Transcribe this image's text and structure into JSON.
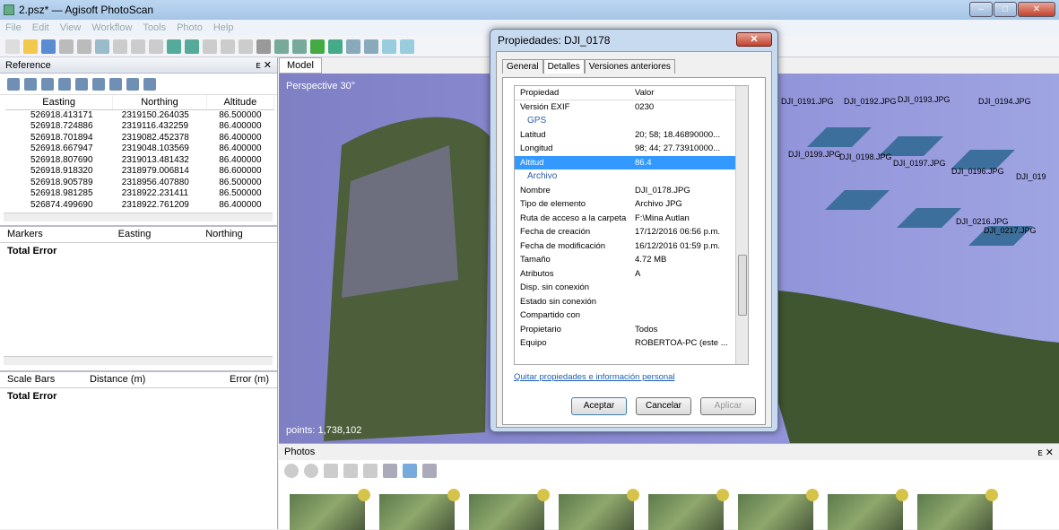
{
  "window": {
    "title": "2.psz* — Agisoft PhotoScan"
  },
  "menu": [
    "File",
    "Edit",
    "View",
    "Workflow",
    "Tools",
    "Photo",
    "Help"
  ],
  "reference": {
    "title": "Reference",
    "columns": [
      "Easting",
      "Northing",
      "Altitude"
    ],
    "rows": [
      [
        "526918.413171",
        "2319150.264035",
        "86.500000"
      ],
      [
        "526918.724886",
        "2319116.432259",
        "86.400000"
      ],
      [
        "526918.701894",
        "2319082.452378",
        "86.400000"
      ],
      [
        "526918.667947",
        "2319048.103569",
        "86.400000"
      ],
      [
        "526918.807690",
        "2319013.481432",
        "86.400000"
      ],
      [
        "526918.918320",
        "2318979.006814",
        "86.600000"
      ],
      [
        "526918.905789",
        "2318956.407880",
        "86.500000"
      ],
      [
        "526918.981285",
        "2318922.231411",
        "86.500000"
      ],
      [
        "526874.499690",
        "2318922.761209",
        "86.400000"
      ]
    ],
    "markers": {
      "columns": [
        "Markers",
        "Easting",
        "Northing"
      ],
      "total": "Total Error"
    },
    "scalebars": {
      "columns": [
        "Scale Bars",
        "Distance (m)",
        "Error (m)"
      ],
      "total": "Total Error"
    }
  },
  "model": {
    "tab": "Model",
    "perspective": "Perspective 30°",
    "points": "points: 1,738,102",
    "cameras": [
      "DJI_0191.JPG",
      "DJI_0192.JPG",
      "DJI_0193.JPG",
      "DJI_0194.JPG",
      "DJI_0199.JPG",
      "DJI_0198.JPG",
      "DJI_0197.JPG",
      "DJI_0196.JPG",
      "DJI_0216.JPG",
      "DJI_0217.JPG",
      "DJI_019"
    ]
  },
  "photos": {
    "title": "Photos"
  },
  "dialog": {
    "title": "Propiedades: DJI_0178",
    "tabs": [
      "General",
      "Detalles",
      "Versiones anteriores"
    ],
    "header": [
      "Propiedad",
      "Valor"
    ],
    "rows": [
      {
        "k": "Versión EXIF",
        "v": "0230"
      },
      {
        "group": "GPS"
      },
      {
        "k": "Latitud",
        "v": "20; 58; 18.46890000..."
      },
      {
        "k": "Longitud",
        "v": "98; 44; 27.73910000..."
      },
      {
        "k": "Altitud",
        "v": "86.4",
        "selected": true
      },
      {
        "group": "Archivo"
      },
      {
        "k": "Nombre",
        "v": "DJI_0178.JPG"
      },
      {
        "k": "Tipo de elemento",
        "v": "Archivo JPG"
      },
      {
        "k": "Ruta de acceso a la carpeta",
        "v": "F:\\Mina Autlan"
      },
      {
        "k": "Fecha de creación",
        "v": "17/12/2016 06:56 p.m."
      },
      {
        "k": "Fecha de modificación",
        "v": "16/12/2016 01:59 p.m."
      },
      {
        "k": "Tamaño",
        "v": "4.72 MB"
      },
      {
        "k": "Atributos",
        "v": "A"
      },
      {
        "k": "Disp. sin conexión",
        "v": ""
      },
      {
        "k": "Estado sin conexión",
        "v": ""
      },
      {
        "k": "Compartido con",
        "v": ""
      },
      {
        "k": "Propietario",
        "v": "Todos"
      },
      {
        "k": "Equipo",
        "v": "ROBERTOA-PC (este ..."
      }
    ],
    "link": "Quitar propiedades e información personal",
    "buttons": {
      "ok": "Aceptar",
      "cancel": "Cancelar",
      "apply": "Aplicar"
    }
  }
}
